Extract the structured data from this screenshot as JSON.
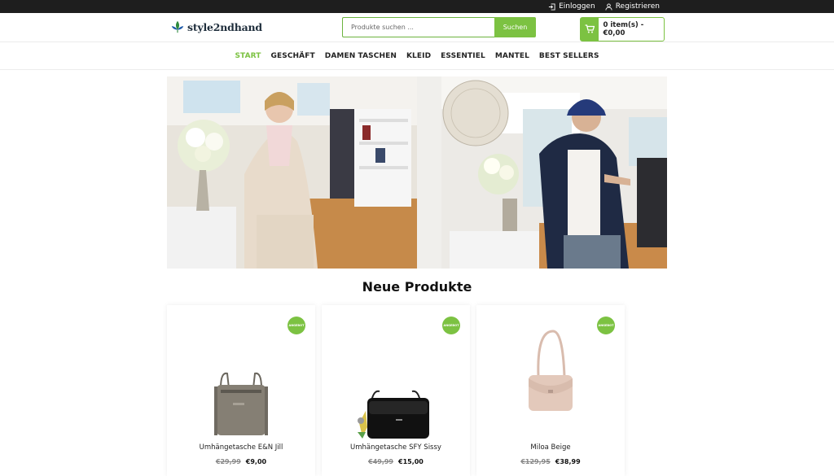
{
  "topbar": {
    "login": "Einloggen",
    "register": "Registrieren"
  },
  "header": {
    "logo_text": "style2ndhand",
    "search_placeholder": "Produkte suchen ...",
    "search_button": "Suchen",
    "cart_text": "0 item(s) - €0,00"
  },
  "nav": {
    "items": [
      "START",
      "GESCHÄFT",
      "DAMEN TASCHEN",
      "KLEID",
      "ESSENTIEL",
      "MANTEL",
      "BEST SELLERS"
    ]
  },
  "section": {
    "title": "Neue Produkte"
  },
  "products": [
    {
      "name": "Umhängetasche E&N Jill",
      "old_price": "€29,99",
      "price": "€9,00",
      "badge": "ANGEBOT"
    },
    {
      "name": "Umhängetasche SFY Sissy",
      "old_price": "€49,99",
      "price": "€15,00",
      "badge": "ANGEBOT"
    },
    {
      "name": "Miloa Beige",
      "old_price": "€129,95",
      "price": "€38,99",
      "badge": "ANGEBOT"
    }
  ],
  "colors": {
    "accent": "#7cc242",
    "topbar": "#1e1e1e"
  }
}
